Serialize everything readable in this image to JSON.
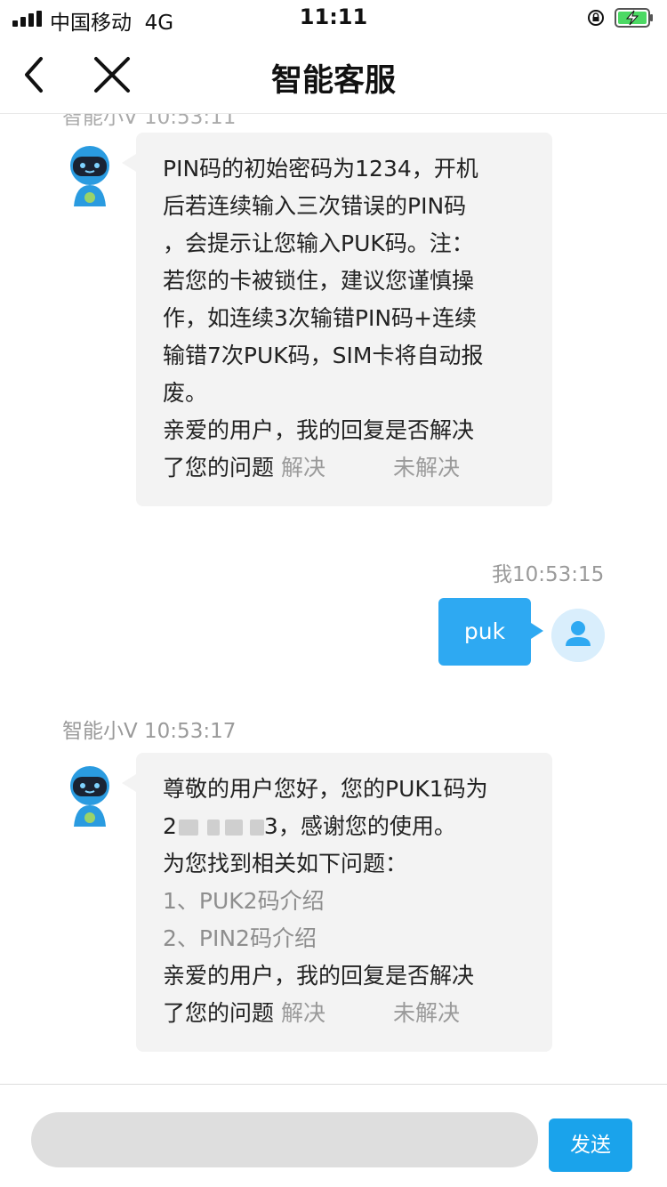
{
  "status_bar": {
    "carrier": "中国移动",
    "network": "4G",
    "time": "11:11"
  },
  "nav": {
    "title": "智能客服"
  },
  "chat": {
    "cut_label": "智能小V 10:53:11",
    "bot_reply_1": {
      "lines": [
        "PIN码的初始密码为1234，开机",
        "后若连续输入三次错误的PIN码",
        "，会提示让您输入PUK码。注：",
        "若您的卡被锁住，建议您谨慎操",
        "作，如连续3次输错PIN码+连续",
        "输错7次PUK码，SIM卡将自动报",
        "废。"
      ],
      "feedback_prompt_1": "亲爱的用户，我的回复是否解决",
      "feedback_prompt_2": "了您的问题",
      "solved": "解决",
      "unsolved": "未解决"
    },
    "user_meta": "我10:53:15",
    "user_message": "puk",
    "bot_meta": "智能小V 10:53:17",
    "bot_reply_2": {
      "line1": "尊敬的用户您好，您的PUK1码为",
      "puk_first_char": "2",
      "puk_last_char": "3",
      "line2_suffix": "，感谢您的使用。",
      "line3": "为您找到相关如下问题：",
      "related": [
        "1、PUK2码介绍",
        "2、PIN2码介绍"
      ],
      "feedback_prompt_1": "亲爱的用户，我的回复是否解决",
      "feedback_prompt_2": "了您的问题",
      "solved": "解决",
      "unsolved": "未解决"
    }
  },
  "input_bar": {
    "placeholder": "",
    "send_label": "发送"
  },
  "colors": {
    "accent": "#2ea9f2",
    "send_button": "#1aa3eb",
    "bubble_gray": "#f3f3f3"
  }
}
